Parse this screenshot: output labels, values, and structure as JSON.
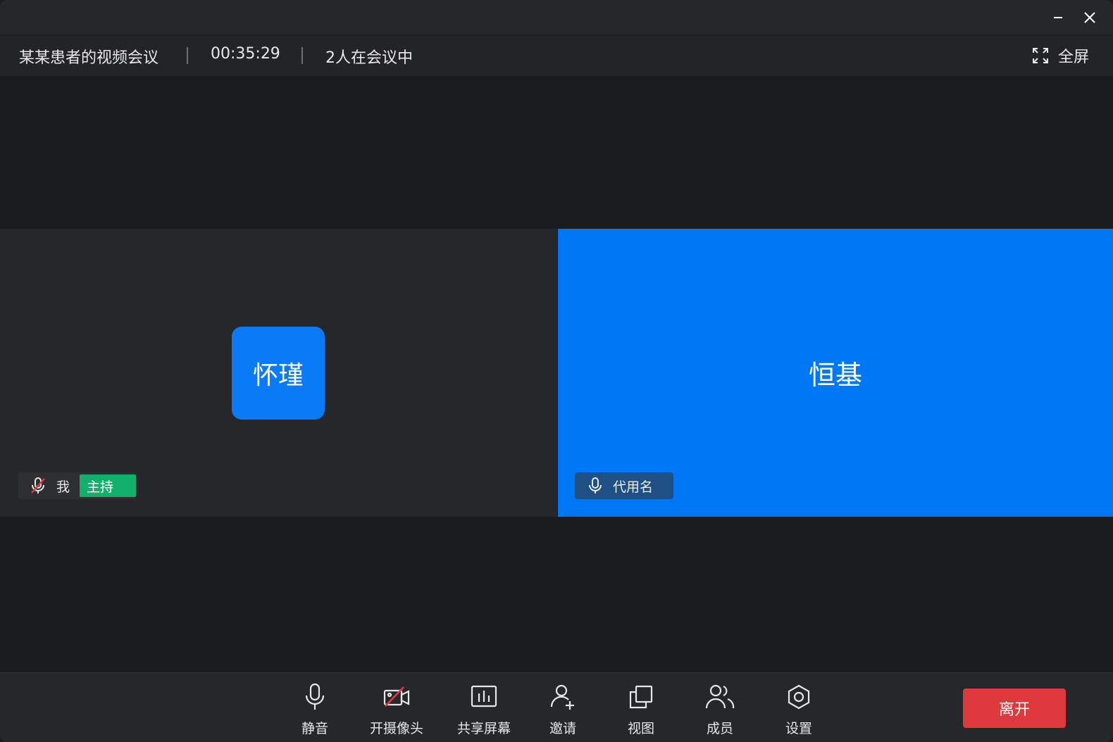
{
  "window": {
    "minimize_icon": "minimize-icon",
    "close_icon": "close-icon"
  },
  "meeting": {
    "title": "某某患者的视频会议",
    "elapsed": "00:35:29",
    "participants_text": "2人在会议中",
    "fullscreen_label": "全屏"
  },
  "participants": [
    {
      "display": "怀瑾",
      "tag": "我",
      "role_badge": "主持",
      "mic": "muted",
      "tile_color": "#26272b"
    },
    {
      "display": "恒基",
      "tag": "代用名",
      "mic": "on",
      "tile_color": "#0078f5"
    }
  ],
  "toolbar": {
    "items": [
      {
        "label": "静音",
        "icon": "microphone-icon"
      },
      {
        "label": "开摄像头",
        "icon": "camera-off-icon"
      },
      {
        "label": "共享屏幕",
        "icon": "share-screen-icon"
      },
      {
        "label": "邀请",
        "icon": "invite-user-icon"
      },
      {
        "label": "视图",
        "icon": "view-layout-icon"
      },
      {
        "label": "成员",
        "icon": "members-icon"
      },
      {
        "label": "设置",
        "icon": "settings-icon"
      }
    ],
    "leave_label": "离开"
  },
  "colors": {
    "accent_blue": "#0078f5",
    "host_green": "#13b06b",
    "leave_red": "#de3a3d",
    "background": "#1b1c1e"
  }
}
